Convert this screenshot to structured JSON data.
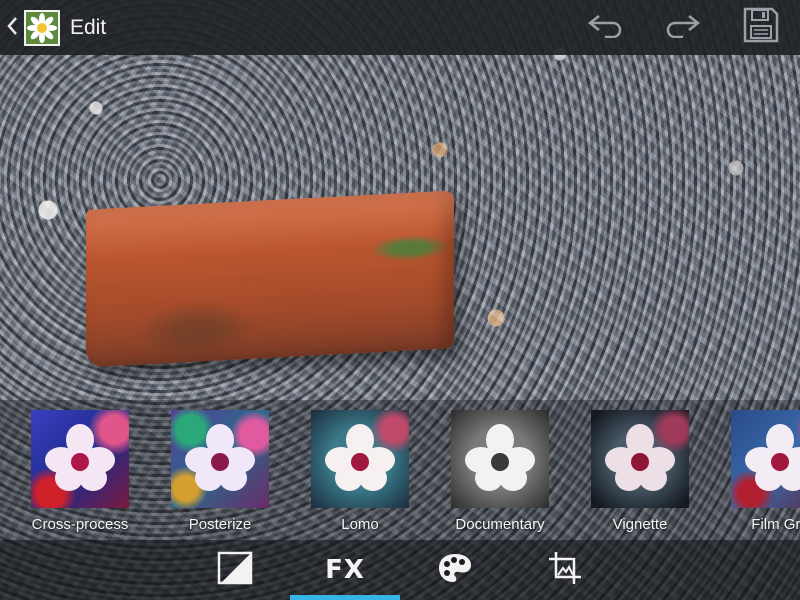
{
  "action_bar": {
    "title": "Edit",
    "up_icon": "chevron-left-icon",
    "app_icon": "daisy-thumbnail-icon",
    "actions": [
      {
        "name": "undo",
        "icon": "undo-arrow-icon"
      },
      {
        "name": "redo",
        "icon": "redo-arrow-icon"
      },
      {
        "name": "save",
        "icon": "floppy-disk-icon"
      }
    ]
  },
  "photo": {
    "subject": "brick-on-gravel"
  },
  "filters": [
    {
      "label": "Cross-process"
    },
    {
      "label": "Posterize"
    },
    {
      "label": "Lomo"
    },
    {
      "label": "Documentary"
    },
    {
      "label": "Vignette"
    },
    {
      "label": "Film Gra"
    }
  ],
  "bottom_nav": {
    "items": [
      {
        "name": "brightness",
        "icon": "exposure-half-square-icon"
      },
      {
        "name": "fx",
        "label": "FX",
        "active": true
      },
      {
        "name": "color",
        "icon": "palette-icon"
      },
      {
        "name": "crop",
        "icon": "crop-icon"
      }
    ],
    "accent_color": "#33b5e5"
  }
}
